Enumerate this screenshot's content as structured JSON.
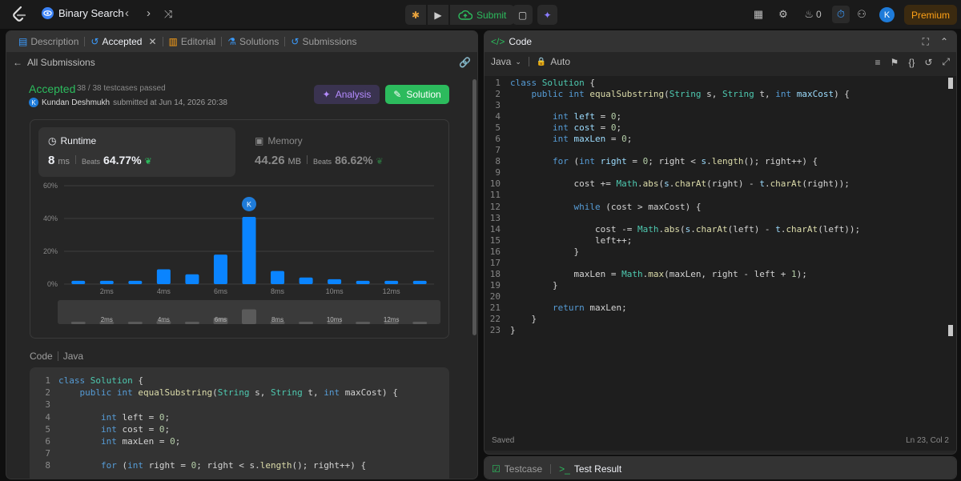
{
  "header": {
    "problem_title": "Binary Search",
    "submit_label": "Submit",
    "streak": "0",
    "premium_label": "Premium",
    "avatar_letter": "K"
  },
  "left_tabs": [
    {
      "label": "Description"
    },
    {
      "label": "Accepted"
    },
    {
      "label": "Editorial"
    },
    {
      "label": "Solutions"
    },
    {
      "label": "Submissions"
    }
  ],
  "submission": {
    "back_label": "All Submissions",
    "status": "Accepted",
    "testcases": "38 / 38 testcases passed",
    "user": "Kundan Deshmukh",
    "submitted_text": "submitted at Jun 14, 2026 20:38",
    "user_letter": "K",
    "analysis_label": "Analysis",
    "solution_label": "Solution",
    "runtime": {
      "label": "Runtime",
      "value": "8",
      "unit": "ms",
      "beats_label": "Beats",
      "beats": "64.77%"
    },
    "memory": {
      "label": "Memory",
      "value": "44.26",
      "unit": "MB",
      "beats_label": "Beats",
      "beats": "86.62%"
    },
    "code_label": "Code",
    "language": "Java"
  },
  "chart_data": {
    "type": "bar",
    "categories": [
      "1ms",
      "2ms",
      "3ms",
      "4ms",
      "5ms",
      "6ms",
      "7ms",
      "8ms",
      "9ms",
      "10ms",
      "11ms",
      "12ms",
      "13ms"
    ],
    "values": [
      2,
      2,
      2,
      9,
      6,
      18,
      41,
      8,
      4,
      3,
      2,
      2,
      2
    ],
    "highlight_index": 7,
    "highlight_marker": "K",
    "x_tick_labels": [
      "2ms",
      "4ms",
      "6ms",
      "8ms",
      "10ms",
      "12ms"
    ],
    "y_tick_labels": [
      "60%",
      "40%",
      "20%",
      "0%"
    ],
    "ylim": [
      0,
      60
    ],
    "overview_values": [
      2,
      2,
      2,
      9,
      6,
      18,
      41,
      8,
      4,
      3,
      2,
      2,
      2
    ],
    "accent": "#0a84ff"
  },
  "code_lines": [
    [
      [
        "kw",
        "class "
      ],
      [
        "ty",
        "Solution"
      ],
      [
        "pl",
        " {"
      ]
    ],
    [
      [
        "pl",
        "    "
      ],
      [
        "kw",
        "public int "
      ],
      [
        "fn",
        "equalSubstring"
      ],
      [
        "pl",
        "("
      ],
      [
        "ty",
        "String"
      ],
      [
        "pl",
        " s, "
      ],
      [
        "ty",
        "String"
      ],
      [
        "pl",
        " t, "
      ],
      [
        "kw",
        "int "
      ],
      [
        "pl",
        "maxCost) {"
      ]
    ],
    [
      [
        "pl",
        ""
      ]
    ],
    [
      [
        "pl",
        "        "
      ],
      [
        "kw",
        "int "
      ],
      [
        "pl",
        "left = "
      ],
      [
        "nm",
        "0"
      ],
      [
        "pl",
        ";"
      ]
    ],
    [
      [
        "pl",
        "        "
      ],
      [
        "kw",
        "int "
      ],
      [
        "pl",
        "cost = "
      ],
      [
        "nm",
        "0"
      ],
      [
        "pl",
        ";"
      ]
    ],
    [
      [
        "pl",
        "        "
      ],
      [
        "kw",
        "int "
      ],
      [
        "pl",
        "maxLen = "
      ],
      [
        "nm",
        "0"
      ],
      [
        "pl",
        ";"
      ]
    ],
    [
      [
        "pl",
        ""
      ]
    ],
    [
      [
        "pl",
        "        "
      ],
      [
        "kw",
        "for "
      ],
      [
        "pl",
        "("
      ],
      [
        "kw",
        "int "
      ],
      [
        "pl",
        "right = "
      ],
      [
        "nm",
        "0"
      ],
      [
        "pl",
        "; right < s."
      ],
      [
        "fn",
        "length"
      ],
      [
        "pl",
        "(); right++) {"
      ]
    ]
  ],
  "editor": {
    "title": "Code",
    "language": "Java",
    "mode": "Auto",
    "saved": "Saved",
    "cursor": "Ln 23, Col 2",
    "lines": [
      [
        [
          "kw",
          "class "
        ],
        [
          "ty",
          "Solution"
        ],
        [
          "pl",
          " {"
        ]
      ],
      [
        [
          "pl",
          "    "
        ],
        [
          "kw",
          "public int "
        ],
        [
          "fn",
          "equalSubstring"
        ],
        [
          "pl",
          "("
        ],
        [
          "ty",
          "String"
        ],
        [
          "pl",
          " s, "
        ],
        [
          "ty",
          "String"
        ],
        [
          "pl",
          " t, "
        ],
        [
          "kw",
          "int "
        ],
        [
          "vr",
          "maxCost"
        ],
        [
          "pl",
          ") {"
        ]
      ],
      [
        [
          "pl",
          ""
        ]
      ],
      [
        [
          "pl",
          "        "
        ],
        [
          "kw",
          "int "
        ],
        [
          "vr",
          "left"
        ],
        [
          "pl",
          " = "
        ],
        [
          "nm",
          "0"
        ],
        [
          "pl",
          ";"
        ]
      ],
      [
        [
          "pl",
          "        "
        ],
        [
          "kw",
          "int "
        ],
        [
          "vr",
          "cost"
        ],
        [
          "pl",
          " = "
        ],
        [
          "nm",
          "0"
        ],
        [
          "pl",
          ";"
        ]
      ],
      [
        [
          "pl",
          "        "
        ],
        [
          "kw",
          "int "
        ],
        [
          "vr",
          "maxLen"
        ],
        [
          "pl",
          " = "
        ],
        [
          "nm",
          "0"
        ],
        [
          "pl",
          ";"
        ]
      ],
      [
        [
          "pl",
          ""
        ]
      ],
      [
        [
          "pl",
          "        "
        ],
        [
          "kw",
          "for "
        ],
        [
          "pl",
          "("
        ],
        [
          "kw",
          "int "
        ],
        [
          "vr",
          "right"
        ],
        [
          "pl",
          " = "
        ],
        [
          "nm",
          "0"
        ],
        [
          "pl",
          "; right < "
        ],
        [
          "vr",
          "s"
        ],
        [
          "pl",
          "."
        ],
        [
          "fn",
          "length"
        ],
        [
          "pl",
          "(); right++) {"
        ]
      ],
      [
        [
          "pl",
          ""
        ]
      ],
      [
        [
          "pl",
          "            cost += "
        ],
        [
          "ty",
          "Math"
        ],
        [
          "pl",
          "."
        ],
        [
          "fn",
          "abs"
        ],
        [
          "pl",
          "("
        ],
        [
          "vr",
          "s"
        ],
        [
          "pl",
          "."
        ],
        [
          "fn",
          "charAt"
        ],
        [
          "pl",
          "(right) - "
        ],
        [
          "vr",
          "t"
        ],
        [
          "pl",
          "."
        ],
        [
          "fn",
          "charAt"
        ],
        [
          "pl",
          "(right));"
        ]
      ],
      [
        [
          "pl",
          ""
        ]
      ],
      [
        [
          "pl",
          "            "
        ],
        [
          "kw",
          "while "
        ],
        [
          "pl",
          "(cost > maxCost) {"
        ]
      ],
      [
        [
          "pl",
          ""
        ]
      ],
      [
        [
          "pl",
          "                cost -= "
        ],
        [
          "ty",
          "Math"
        ],
        [
          "pl",
          "."
        ],
        [
          "fn",
          "abs"
        ],
        [
          "pl",
          "("
        ],
        [
          "vr",
          "s"
        ],
        [
          "pl",
          "."
        ],
        [
          "fn",
          "charAt"
        ],
        [
          "pl",
          "(left) - "
        ],
        [
          "vr",
          "t"
        ],
        [
          "pl",
          "."
        ],
        [
          "fn",
          "charAt"
        ],
        [
          "pl",
          "(left));"
        ]
      ],
      [
        [
          "pl",
          "                left++;"
        ]
      ],
      [
        [
          "pl",
          "            }"
        ]
      ],
      [
        [
          "pl",
          ""
        ]
      ],
      [
        [
          "pl",
          "            maxLen = "
        ],
        [
          "ty",
          "Math"
        ],
        [
          "pl",
          "."
        ],
        [
          "fn",
          "max"
        ],
        [
          "pl",
          "(maxLen, right - left + "
        ],
        [
          "nm",
          "1"
        ],
        [
          "pl",
          ");"
        ]
      ],
      [
        [
          "pl",
          "        }"
        ]
      ],
      [
        [
          "pl",
          ""
        ]
      ],
      [
        [
          "pl",
          "        "
        ],
        [
          "kw",
          "return "
        ],
        [
          "pl",
          "maxLen;"
        ]
      ],
      [
        [
          "pl",
          "    }"
        ]
      ],
      [
        [
          "pl",
          "}"
        ]
      ]
    ]
  },
  "bottom_tabs": [
    {
      "label": "Testcase"
    },
    {
      "label": "Test Result"
    }
  ]
}
